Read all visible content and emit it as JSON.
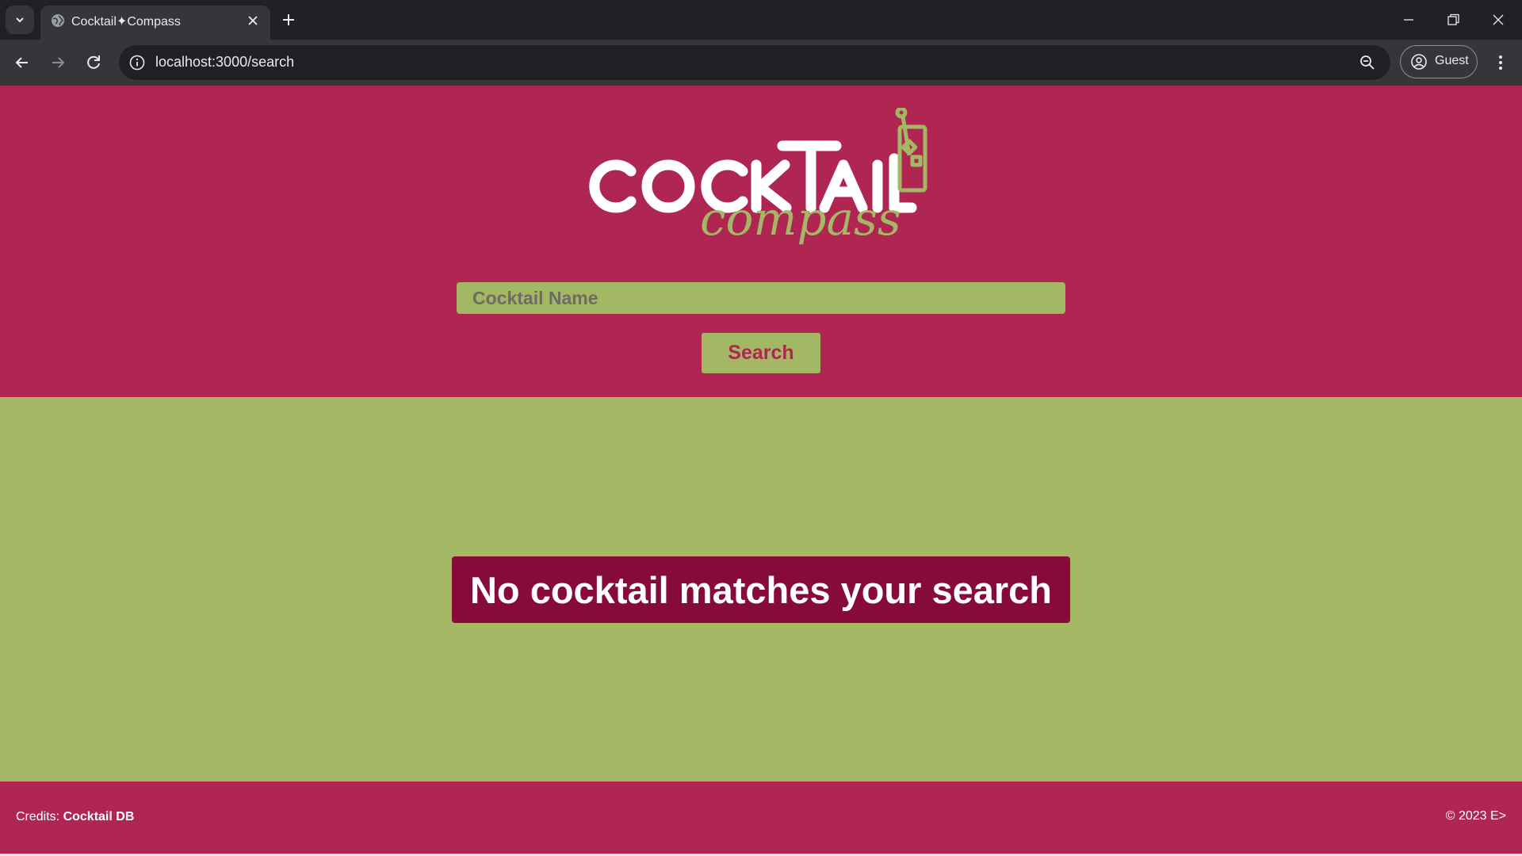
{
  "browser": {
    "tab_title": "Cocktail✦Compass",
    "url": "localhost:3000/search",
    "profile_label": "Guest",
    "icons": {
      "tab_list": "chevron-down-icon",
      "favicon": "globe-icon",
      "tab_close": "close-icon",
      "new_tab": "plus-icon",
      "minimize": "minimize-icon",
      "restore": "restore-icon",
      "close_window": "close-icon",
      "back": "arrow-left-icon",
      "forward": "arrow-right-icon",
      "reload": "reload-icon",
      "site_info": "info-icon",
      "zoom": "zoom-out-icon",
      "profile": "account-circle-icon",
      "menu": "more-vert-icon"
    }
  },
  "header": {
    "logo_text": "COCKTAIL compass",
    "search": {
      "placeholder": "Cocktail Name",
      "value": "",
      "button_label": "Search"
    }
  },
  "main": {
    "message": "No cocktail matches your search"
  },
  "footer": {
    "credits_prefix": "Credits: ",
    "credits_source": "Cocktail DB",
    "copyright": "© 2023 E>"
  },
  "colors": {
    "header_bg": "#b02653",
    "main_bg": "#a4b764",
    "message_bg": "#870b3a",
    "accent_green": "#a4b764"
  }
}
